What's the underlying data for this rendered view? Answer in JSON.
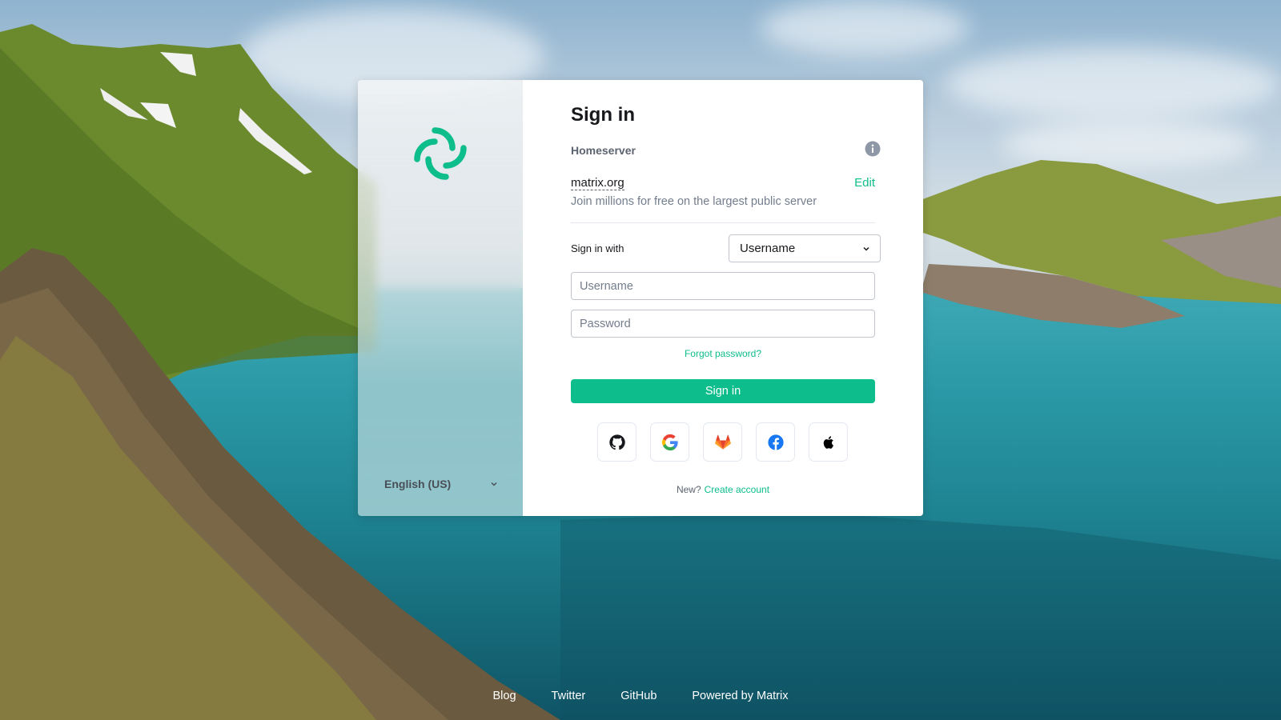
{
  "auth": {
    "title": "Sign in",
    "homeserver": {
      "label": "Homeserver",
      "name": "matrix.org",
      "edit_label": "Edit",
      "description": "Join millions for free on the largest public server"
    },
    "sign_in_with_label": "Sign in with",
    "sign_in_with_selected": "Username",
    "username_placeholder": "Username",
    "password_placeholder": "Password",
    "forgot_password": "Forgot password?",
    "sign_in_button": "Sign in",
    "sso_providers": [
      "github-icon",
      "google-icon",
      "gitlab-icon",
      "facebook-icon",
      "apple-icon"
    ],
    "new_label": "New?",
    "create_account": "Create account"
  },
  "language": {
    "selected": "English (US)"
  },
  "footer": {
    "links": [
      "Blog",
      "Twitter",
      "GitHub",
      "Powered by Matrix"
    ]
  },
  "colors": {
    "accent": "#0dbd8b",
    "text": "#17191c",
    "muted": "#737d8c"
  }
}
